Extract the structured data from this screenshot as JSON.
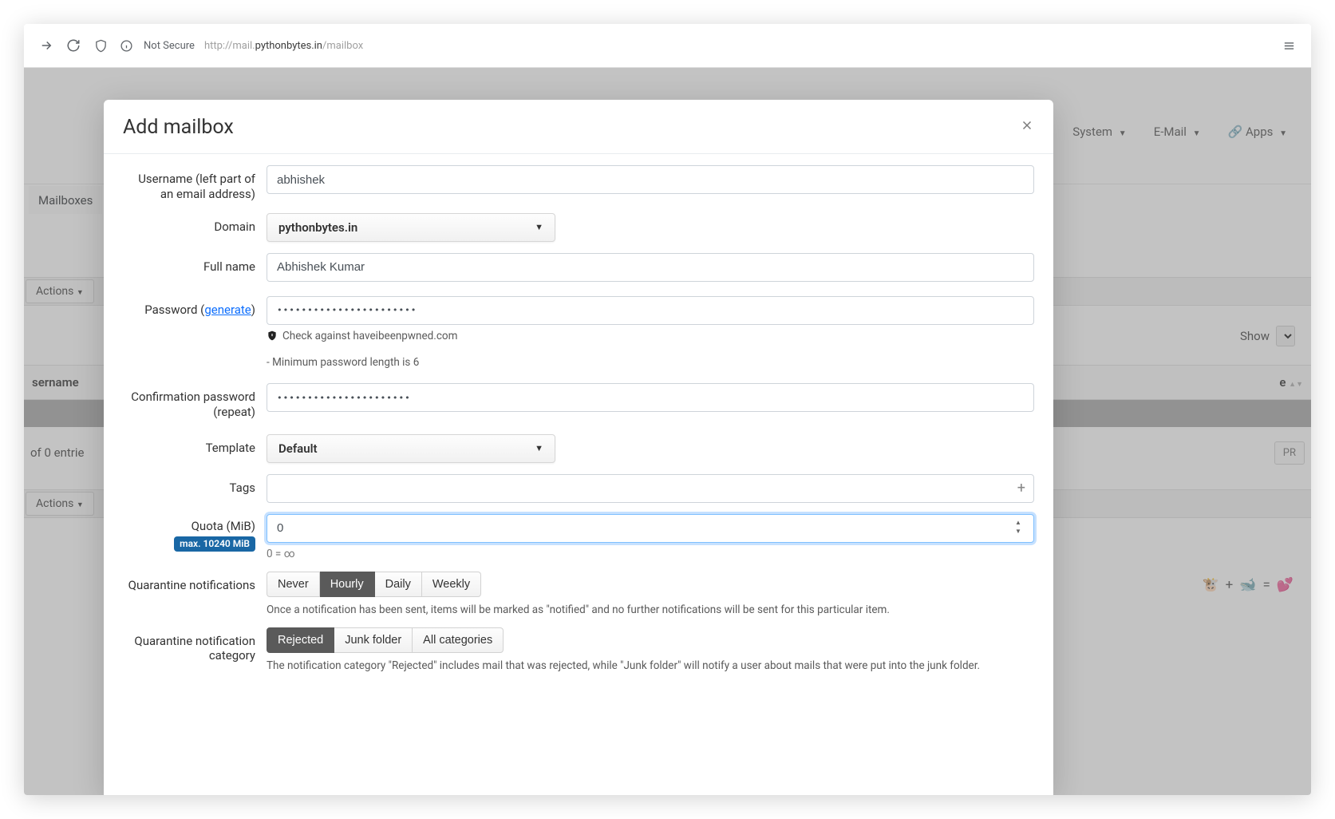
{
  "browser": {
    "not_secure": "Not Secure",
    "url_prefix": "http://mail.",
    "url_domain": "pythonbytes.in",
    "url_path": "/mailbox"
  },
  "topnav": {
    "system": "System",
    "email": "E-Mail",
    "apps": "Apps"
  },
  "page": {
    "tab_mailboxes": "Mailboxes",
    "actions": "Actions",
    "th_username": "sername",
    "th_right": "e",
    "entries": "of 0 entrie",
    "pr": "PR",
    "show": "Show"
  },
  "modal": {
    "title": "Add mailbox",
    "labels": {
      "username": "Username (left part of an email address)",
      "domain": "Domain",
      "full_name": "Full name",
      "password_prefix": "Password (",
      "generate": "generate",
      "password_suffix": ")",
      "confirm": "Confirmation password (repeat)",
      "template": "Template",
      "tags": "Tags",
      "quota": "Quota (MiB)",
      "quarantine": "Quarantine notifications",
      "quarantine_cat": "Quarantine notification category"
    },
    "values": {
      "username": "abhishek",
      "domain": "pythonbytes.in",
      "full_name": "Abhishek Kumar",
      "password": "•••••••••••••••••••••••",
      "confirm_password": "••••••••••••••••••••••",
      "template": "Default",
      "quota": "0"
    },
    "hints": {
      "hibp": "Check against haveibeenpwned.com",
      "min_pw": "- Minimum password length is 6",
      "quota_max": "max. 10240 MiB",
      "quota_zero": "0 = ∞",
      "qn_note": "Once a notification has been sent, items will be marked as \"notified\" and no further notifications will be sent for this particular item.",
      "qc_note": "The notification category \"Rejected\" includes mail that was rejected, while \"Junk folder\" will notify a user about mails that were put into the junk folder."
    },
    "qn_options": [
      "Never",
      "Hourly",
      "Daily",
      "Weekly"
    ],
    "qn_active": 1,
    "qc_options": [
      "Rejected",
      "Junk folder",
      "All categories"
    ],
    "qc_active": 0
  }
}
